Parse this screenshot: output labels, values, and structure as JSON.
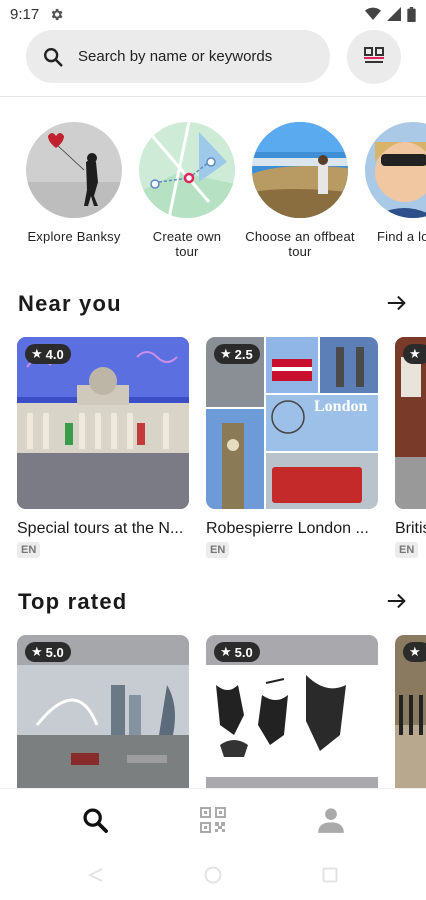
{
  "status": {
    "time": "9:17"
  },
  "search": {
    "placeholder": "Search by name or keywords"
  },
  "categories": [
    {
      "label": "Explore Banksy"
    },
    {
      "label": "Create own tour"
    },
    {
      "label": "Choose an offbeat tour"
    },
    {
      "label": "Find a lo"
    }
  ],
  "near_you": {
    "title": "Near you",
    "cards": [
      {
        "rating": "4.0",
        "title": "Special tours at the N...",
        "lang": "EN"
      },
      {
        "rating": "2.5",
        "title": "Robespierre London ...",
        "lang": "EN"
      },
      {
        "rating": "",
        "title": "Britis",
        "lang": "EN"
      }
    ],
    "london_text": "London"
  },
  "top_rated": {
    "title": "Top rated",
    "cards": [
      {
        "rating": "5.0"
      },
      {
        "rating": "5.0"
      },
      {
        "rating": ""
      }
    ]
  },
  "icons": {
    "settings": "gear-icon",
    "wifi": "wifi-icon",
    "signal": "signal-icon",
    "battery": "battery-icon",
    "search": "search-icon",
    "qr": "qr-code-icon",
    "arrow": "arrow-right-icon",
    "nav_search": "search-icon",
    "nav_qr": "qr-code-icon",
    "nav_profile": "person-icon"
  },
  "colors": {
    "accent": "#e0245e",
    "rating_bg": "#2b2b2b",
    "search_bg": "#ebebeb"
  }
}
